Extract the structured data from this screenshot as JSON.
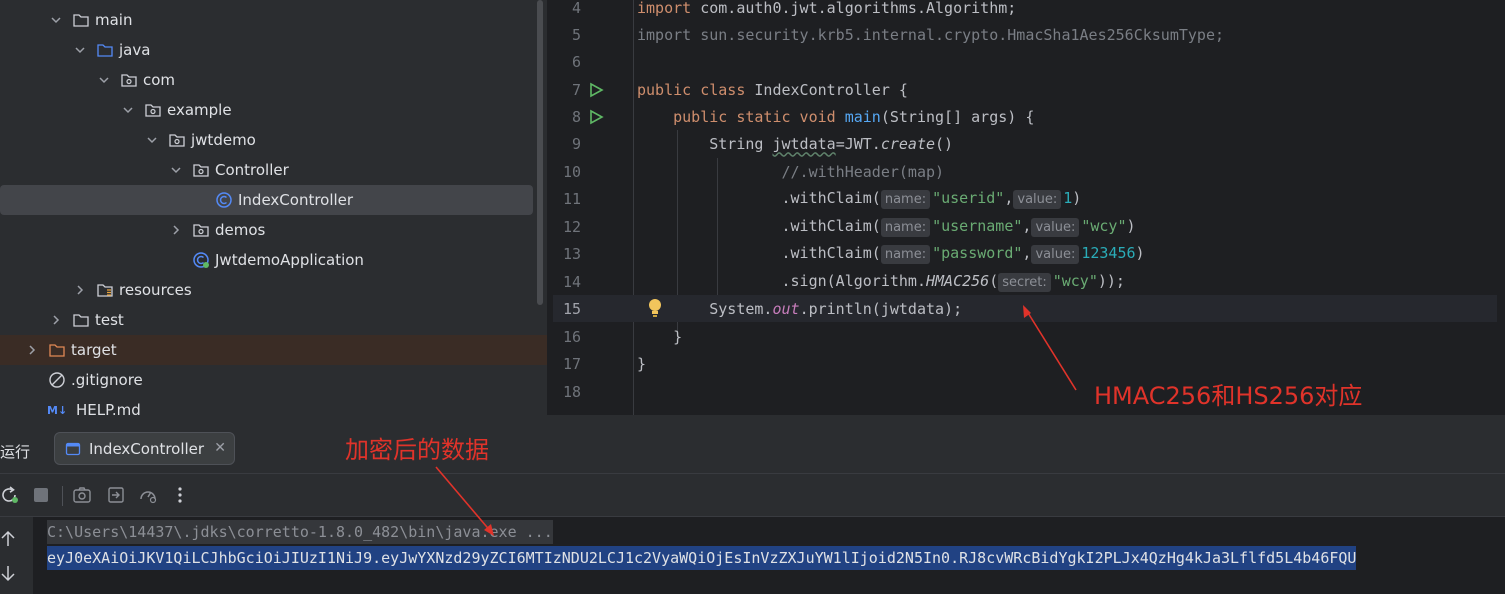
{
  "tree": {
    "items": [
      {
        "label": "main",
        "indent": 2,
        "icon": "folder-icon",
        "expanded": true
      },
      {
        "label": "java",
        "indent": 3,
        "icon": "source-folder-icon",
        "expanded": true
      },
      {
        "label": "com",
        "indent": 4,
        "icon": "package-icon",
        "expanded": true
      },
      {
        "label": "example",
        "indent": 5,
        "icon": "package-icon",
        "expanded": true
      },
      {
        "label": "jwtdemo",
        "indent": 6,
        "icon": "package-icon",
        "expanded": true
      },
      {
        "label": "Controller",
        "indent": 7,
        "icon": "package-icon",
        "expanded": true
      },
      {
        "label": "IndexController",
        "indent": 8,
        "icon": "java-class-icon",
        "selected": true
      },
      {
        "label": "demos",
        "indent": 7,
        "icon": "package-icon",
        "expanded": false
      },
      {
        "label": "JwtdemoApplication",
        "indent": 7,
        "icon": "spring-class-icon"
      },
      {
        "label": "resources",
        "indent": 3,
        "icon": "resources-folder-icon",
        "expanded": false
      },
      {
        "label": "test",
        "indent": 2,
        "icon": "folder-icon",
        "expanded": false
      },
      {
        "label": "target",
        "indent": 1,
        "icon": "excluded-folder-icon",
        "expanded": false,
        "excluded": true
      },
      {
        "label": ".gitignore",
        "indent": 1,
        "icon": "ignore-file-icon"
      },
      {
        "label": "HELP.md",
        "indent": 1,
        "icon": "markdown-file-icon"
      }
    ]
  },
  "editor": {
    "line_numbers": [
      "4",
      "5",
      "6",
      "7",
      "8",
      "9",
      "10",
      "11",
      "12",
      "13",
      "14",
      "15",
      "16",
      "17",
      "18"
    ],
    "current_line": "15",
    "lines": {
      "l4": {
        "kw": "import",
        "rest": " com.auth0.jwt.algorithms.Algorithm;"
      },
      "l5": {
        "kw": "import",
        "rest": " sun.security.krb5.internal.crypto.HmacSha1Aes256CksumType;"
      },
      "l7": {
        "kw": "public class",
        "name": " IndexController {"
      },
      "l8": {
        "kw": "public static void",
        "fn": "main",
        "rest": "(String[] args) {"
      },
      "l9": {
        "type": "String ",
        "var": "jwtdata",
        "eq": "=JWT.",
        "call": "create",
        "end": "()"
      },
      "l10": {
        "comment": "//.withHeader(map)"
      },
      "l11": {
        "pre": ".withClaim(",
        "hint": "name:",
        "str": "\"userid\"",
        "sep": ",",
        "hint2": "value:",
        "val": "1",
        "end": ")"
      },
      "l12": {
        "pre": ".withClaim(",
        "hint": "name:",
        "str": "\"username\"",
        "sep": ",",
        "hint2": "value:",
        "val": "\"wcy\"",
        "end": ")"
      },
      "l13": {
        "pre": ".withClaim(",
        "hint": "name:",
        "str": "\"password\"",
        "sep": ",",
        "hint2": "value:",
        "val": "123456",
        "end": ")"
      },
      "l14": {
        "pre": ".sign(Algorithm.",
        "call": "HMAC256",
        "open": "(",
        "hint": "secret:",
        "str": "\"wcy\"",
        "end": "));"
      },
      "l15": {
        "pre": "System.",
        "field": "out",
        "rest": ".println(jwtdata);"
      },
      "l16": {
        "text": "}"
      },
      "l17": {
        "text": "}"
      }
    }
  },
  "run": {
    "label": "运行",
    "tab_label": "IndexController",
    "tab_close": "✕",
    "command": "C:\\Users\\14437\\.jdks\\corretto-1.8.0_482\\bin\\java.exe ...",
    "output": "eyJ0eXAiOiJKV1QiLCJhbGciOiJIUzI1NiJ9.eyJwYXNzd29yZCI6MTIzNDU2LCJ1c2VyaWQiOjEsInVzZXJuYW1lIjoid2N5In0.RJ8cvWRcBidYgkI2PLJx4QzHg4kJa3Lflfd5L4b46FQU"
  },
  "annotations": {
    "hmac": "HMAC256和HS256对应",
    "encrypted": "加密后的数据"
  },
  "colors": {
    "annotation": "#e0332a",
    "keyword": "#cf8e6d",
    "string": "#6aab73",
    "number": "#2aacb8",
    "selection": "#214283"
  }
}
